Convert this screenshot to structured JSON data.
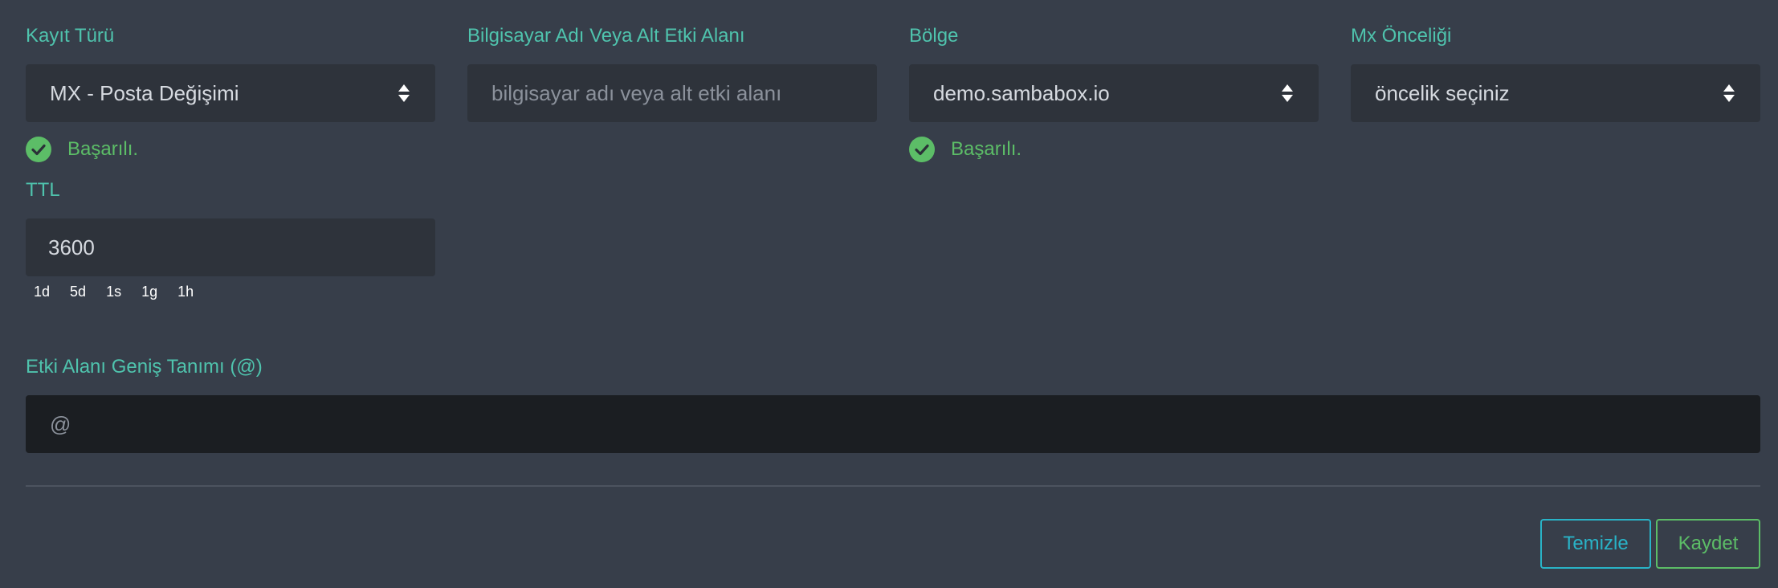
{
  "form": {
    "record_type": {
      "label": "Kayıt Türü",
      "value": "MX - Posta Değişimi",
      "status": "Başarılı."
    },
    "hostname": {
      "label": "Bilgisayar Adı Veya Alt Etki Alanı",
      "placeholder": "bilgisayar adı veya alt etki alanı"
    },
    "zone": {
      "label": "Bölge",
      "value": "demo.sambabox.io",
      "status": "Başarılı."
    },
    "mx_priority": {
      "label": "Mx Önceliği",
      "value": "öncelik seçiniz"
    },
    "ttl": {
      "label": "TTL",
      "value": "3600",
      "shortcuts": [
        "1d",
        "5d",
        "1s",
        "1g",
        "1h"
      ]
    },
    "fqdn": {
      "label": "Etki Alanı Geniş Tanımı (@)",
      "value": "@"
    }
  },
  "actions": {
    "clear_label": "Temizle",
    "save_label": "Kaydet"
  },
  "colors": {
    "background": "#373e4a",
    "label": "#4fc3ad",
    "success": "#5cbd67",
    "clear_button": "#29b3c7",
    "save_button": "#5cbd67"
  },
  "icons": {
    "select_arrow": "sort-icon",
    "status": "check-circle-icon"
  }
}
